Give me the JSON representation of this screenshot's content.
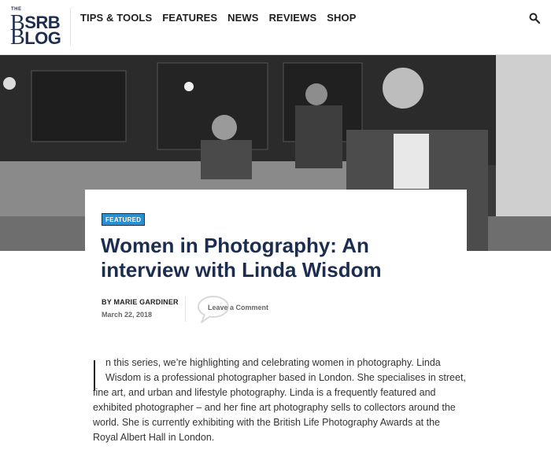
{
  "logo": {
    "the": "THE",
    "line1": "SRB",
    "line2": "LOG",
    "b": "B"
  },
  "nav": {
    "items": [
      "TIPS & TOOLS",
      "FEATURES",
      "NEWS",
      "REVIEWS",
      "SHOP"
    ]
  },
  "icons": {
    "search": "search-icon",
    "comment": "speech-bubble-icon"
  },
  "colors": {
    "brand": "#1d2d50",
    "badge": "#2a8fd1"
  },
  "article": {
    "badge": "FEATURED",
    "title": "Women in Photography: An interview with Linda Wisdom",
    "author": "BY MARIE GARDINER",
    "date": "March 22, 2018",
    "comment_label": "Leave a Comment",
    "body_lines": [
      "n this series, we’re highlighting and celebrating women in photography. Linda",
      "Wisdom is a professional photographer based in London. She specialises in street,",
      "fine art, and urban and lifestyle photography. Linda is a frequently featured and",
      "exhibited photographer – and her fine art photography sells to collectors around the",
      "world. She is currently exhibiting with the British Life Photography Awards at the",
      "Royal Albert Hall in London."
    ]
  }
}
